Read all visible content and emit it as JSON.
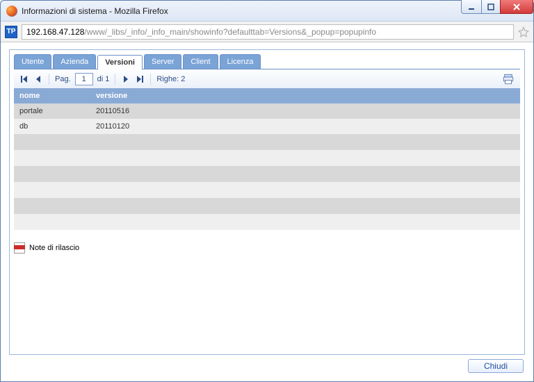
{
  "window": {
    "title": "Informazioni di sistema - Mozilla Firefox"
  },
  "url": {
    "host": "192.168.47.128",
    "path": "/www/_libs/_info/_info_main/showinfo?defaulttab=Versions&_popup=popupinfo"
  },
  "tabs": [
    {
      "label": "Utente"
    },
    {
      "label": "Azienda"
    },
    {
      "label": "Versioni",
      "active": true
    },
    {
      "label": "Server"
    },
    {
      "label": "Client"
    },
    {
      "label": "Licenza"
    }
  ],
  "pager": {
    "page_label": "Pag.",
    "page_value": "1",
    "of_label": "di 1",
    "rows_label": "Righe: 2"
  },
  "table": {
    "headers": {
      "nome": "nome",
      "versione": "versione"
    },
    "rows": [
      {
        "nome": "portale",
        "versione": "20110516"
      },
      {
        "nome": "db",
        "versione": "20110120"
      }
    ]
  },
  "release_notes": {
    "label": "Note di rilascio"
  },
  "footer": {
    "close_label": "Chiudi"
  },
  "favicon": {
    "label": "TP"
  }
}
